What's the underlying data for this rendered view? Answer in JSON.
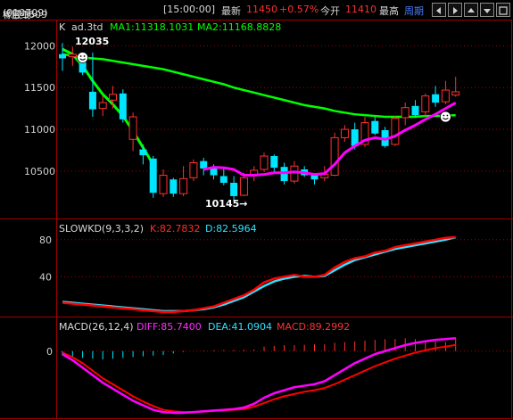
{
  "header": {
    "symbol": "橡胶1609",
    "code": "(010709)",
    "period_label": "<日线>",
    "time": "[15:00:00]",
    "latest_label": "最新",
    "latest_value": "11450",
    "change_pct": "+0.57%",
    "open_label": "今开",
    "open_value": "11410",
    "high_label": "最高",
    "period_link": "周期"
  },
  "toolbar": {
    "buttons": [
      "left-arrow-icon",
      "right-arrow-icon",
      "up-arrow-icon",
      "down-arrow-icon",
      "expand-icon"
    ]
  },
  "main_panel": {
    "legend_k": "K",
    "legend_name": "ad.3td",
    "ma1_label": "MA1:11318.1031",
    "ma2_label": "MA2:11168.8828",
    "y_ticks": [
      "12000",
      "11500",
      "11000",
      "10500"
    ],
    "y_values": [
      12000,
      11500,
      11000,
      10500
    ],
    "high_annotation": "12035",
    "low_annotation": "10145→"
  },
  "kd_panel": {
    "title": "SLOWKD(9,3,3,2)",
    "k_label": "K:82.7832",
    "d_label": "D:82.5964",
    "y_ticks": [
      "80",
      "40"
    ],
    "y_values": [
      80,
      40
    ]
  },
  "macd_panel": {
    "title": "MACD(26,12,4)",
    "diff_label": "DIFF:85.7400",
    "dea_label": "DEA:41.0904",
    "macd_label": "MACD:89.2992",
    "y_ticks": [
      "0"
    ]
  },
  "colors": {
    "up": "#ff3030",
    "down": "#00e5ff",
    "ma_green": "#00ff00",
    "ma_magenta": "#ff00ff",
    "kd_red": "#ff0000",
    "macd_cyan": "#30e0ff",
    "grid_red": "#a00000"
  },
  "chart_data": {
    "type": "candlestick",
    "ylim": [
      10050,
      12250
    ],
    "candles": [
      {
        "o": 11900,
        "h": 12035,
        "l": 11700,
        "c": 11850
      },
      {
        "o": 11870,
        "h": 11990,
        "l": 11760,
        "c": 11900
      },
      {
        "o": 11850,
        "h": 11900,
        "l": 11650,
        "c": 11680
      },
      {
        "o": 11450,
        "h": 11920,
        "l": 11150,
        "c": 11240
      },
      {
        "o": 11250,
        "h": 11400,
        "l": 11160,
        "c": 11320
      },
      {
        "o": 11350,
        "h": 11520,
        "l": 11250,
        "c": 11420
      },
      {
        "o": 11430,
        "h": 11480,
        "l": 11080,
        "c": 11120
      },
      {
        "o": 10880,
        "h": 11200,
        "l": 10740,
        "c": 11150
      },
      {
        "o": 10760,
        "h": 10820,
        "l": 10580,
        "c": 10690
      },
      {
        "o": 10650,
        "h": 10680,
        "l": 10180,
        "c": 10240
      },
      {
        "o": 10230,
        "h": 10520,
        "l": 10190,
        "c": 10450
      },
      {
        "o": 10400,
        "h": 10420,
        "l": 10190,
        "c": 10230
      },
      {
        "o": 10230,
        "h": 10560,
        "l": 10200,
        "c": 10410
      },
      {
        "o": 10420,
        "h": 10640,
        "l": 10380,
        "c": 10600
      },
      {
        "o": 10620,
        "h": 10660,
        "l": 10450,
        "c": 10530
      },
      {
        "o": 10530,
        "h": 10580,
        "l": 10400,
        "c": 10450
      },
      {
        "o": 10440,
        "h": 10540,
        "l": 10330,
        "c": 10360
      },
      {
        "o": 10360,
        "h": 10440,
        "l": 10145,
        "c": 10200
      },
      {
        "o": 10210,
        "h": 10480,
        "l": 10200,
        "c": 10420
      },
      {
        "o": 10450,
        "h": 10560,
        "l": 10380,
        "c": 10510
      },
      {
        "o": 10520,
        "h": 10720,
        "l": 10490,
        "c": 10680
      },
      {
        "o": 10680,
        "h": 10700,
        "l": 10490,
        "c": 10540
      },
      {
        "o": 10550,
        "h": 10600,
        "l": 10340,
        "c": 10380
      },
      {
        "o": 10380,
        "h": 10620,
        "l": 10350,
        "c": 10560
      },
      {
        "o": 10520,
        "h": 10560,
        "l": 10430,
        "c": 10450
      },
      {
        "o": 10450,
        "h": 10460,
        "l": 10340,
        "c": 10400
      },
      {
        "o": 10420,
        "h": 10560,
        "l": 10380,
        "c": 10460
      },
      {
        "o": 10450,
        "h": 10960,
        "l": 10440,
        "c": 10900
      },
      {
        "o": 10900,
        "h": 11050,
        "l": 10850,
        "c": 11000
      },
      {
        "o": 11000,
        "h": 11080,
        "l": 10760,
        "c": 10800
      },
      {
        "o": 10820,
        "h": 11150,
        "l": 10790,
        "c": 11080
      },
      {
        "o": 11100,
        "h": 11150,
        "l": 10930,
        "c": 10950
      },
      {
        "o": 10990,
        "h": 11030,
        "l": 10780,
        "c": 10800
      },
      {
        "o": 10820,
        "h": 11160,
        "l": 10800,
        "c": 11130
      },
      {
        "o": 11140,
        "h": 11320,
        "l": 11050,
        "c": 11260
      },
      {
        "o": 11280,
        "h": 11350,
        "l": 11140,
        "c": 11170
      },
      {
        "o": 11210,
        "h": 11430,
        "l": 11160,
        "c": 11400
      },
      {
        "o": 11420,
        "h": 11520,
        "l": 11270,
        "c": 11320
      },
      {
        "o": 11330,
        "h": 11580,
        "l": 11300,
        "c": 11470
      },
      {
        "o": 11410,
        "h": 11630,
        "l": 11390,
        "c": 11450
      }
    ],
    "ma1": [
      null,
      null,
      null,
      null,
      null,
      null,
      null,
      null,
      null,
      null,
      null,
      null,
      null,
      null,
      10520,
      10545,
      10540,
      10520,
      10450,
      10450,
      10460,
      10480,
      10480,
      10490,
      10480,
      10460,
      10470,
      10580,
      10720,
      10800,
      10870,
      10900,
      10880,
      10920,
      10990,
      11050,
      11120,
      11180,
      11250,
      11318
    ],
    "ma2": [
      11900,
      11880,
      11860,
      11850,
      11840,
      11820,
      11800,
      11780,
      11760,
      11740,
      11720,
      11690,
      11660,
      11630,
      11600,
      11570,
      11540,
      11500,
      11470,
      11440,
      11410,
      11380,
      11350,
      11320,
      11290,
      11270,
      11250,
      11220,
      11200,
      11180,
      11170,
      11160,
      11150,
      11150,
      11150,
      11150,
      11160,
      11160,
      11165,
      11169
    ],
    "short_ma": [
      11960,
      11900,
      11760,
      11580,
      11420,
      11300,
      11160,
      10980,
      10780,
      10580,
      null,
      null,
      null,
      null,
      null,
      null,
      null,
      null,
      null,
      null,
      null,
      null,
      null,
      null,
      null,
      null,
      null,
      null,
      null,
      null,
      null,
      null,
      null,
      null,
      null,
      null,
      null,
      null,
      null,
      null
    ],
    "slowkd_k": [
      12,
      11,
      10,
      9,
      8,
      7,
      6,
      5,
      4,
      3,
      2,
      2,
      3,
      4,
      6,
      8,
      12,
      16,
      20,
      26,
      34,
      38,
      40,
      42,
      40,
      40,
      42,
      50,
      56,
      60,
      62,
      66,
      68,
      72,
      74,
      76,
      78,
      80,
      82,
      82.7832
    ],
    "slowkd_d": [
      13,
      12,
      11,
      10,
      9,
      8,
      7,
      6,
      5,
      4,
      3,
      3,
      3,
      4,
      5,
      7,
      10,
      14,
      18,
      24,
      30,
      35,
      38,
      40,
      41,
      40,
      41,
      47,
      53,
      58,
      61,
      64,
      67,
      70,
      72,
      74,
      76,
      78,
      80,
      82.5964
    ],
    "macd_diff": [
      -20,
      -60,
      -110,
      -160,
      -210,
      -250,
      -290,
      -330,
      -360,
      -390,
      -405,
      -410,
      -410,
      -405,
      -400,
      -395,
      -390,
      -385,
      -375,
      -350,
      -310,
      -280,
      -260,
      -240,
      -230,
      -220,
      -200,
      -160,
      -120,
      -80,
      -50,
      -20,
      0,
      20,
      40,
      55,
      65,
      75,
      80,
      85.74
    ],
    "macd_dea": [
      -10,
      -40,
      -80,
      -130,
      -180,
      -220,
      -260,
      -300,
      -335,
      -365,
      -390,
      -400,
      -405,
      -405,
      -402,
      -398,
      -394,
      -390,
      -385,
      -370,
      -345,
      -320,
      -300,
      -285,
      -270,
      -260,
      -245,
      -220,
      -190,
      -160,
      -130,
      -100,
      -75,
      -50,
      -30,
      -10,
      5,
      20,
      30,
      41.09
    ],
    "macd_bar": [
      -30,
      -35,
      -45,
      -50,
      -55,
      -50,
      -45,
      -40,
      -35,
      -30,
      -25,
      -15,
      -5,
      0,
      5,
      6,
      8,
      8,
      9,
      10,
      30,
      35,
      40,
      40,
      42,
      45,
      45,
      55,
      60,
      65,
      70,
      75,
      80,
      80,
      85,
      80,
      70,
      65,
      60,
      89.3
    ],
    "buy_markers": [
      28,
      35,
      52,
      66
    ],
    "sell_markers": [
      42,
      48,
      60
    ]
  }
}
